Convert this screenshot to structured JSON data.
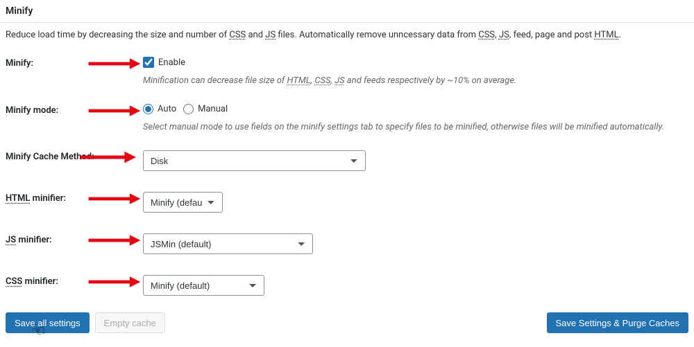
{
  "section": {
    "title": "Minify",
    "description_pre": "Reduce load time by decreasing the size and number of ",
    "description_css": "CSS",
    "description_mid1": " and ",
    "description_js": "JS",
    "description_mid2": " files. Automatically remove unncessary data from ",
    "description_css2": "CSS",
    "description_sep": ", ",
    "description_js2": "JS",
    "description_mid3": ", feed, page and post ",
    "description_html": "HTML",
    "description_end": "."
  },
  "rows": {
    "enable": {
      "label": "Minify:",
      "checkbox_label": "Enable",
      "help_pre": "Minification can decrease file size of ",
      "help_html": "HTML",
      "help_sep": ", ",
      "help_css": "CSS",
      "help_sep2": ", ",
      "help_js": "JS",
      "help_end": " and feeds respectively by ~10% on average."
    },
    "mode": {
      "label": "Minify mode:",
      "option_auto": "Auto",
      "option_manual": "Manual",
      "help": "Select manual mode to use fields on the minify settings tab to specify files to be minified, otherwise files will be minified automatically."
    },
    "cache": {
      "label": "Minify Cache Method:",
      "value": "Disk"
    },
    "html": {
      "label_abbr": "HTML",
      "label_suffix": " minifier:",
      "value": "Minify (default)"
    },
    "js": {
      "label_abbr": "JS",
      "label_suffix": " minifier:",
      "value": "JSMin (default)"
    },
    "css": {
      "label_abbr": "CSS",
      "label_suffix": " minifier:",
      "value": "Minify (default)"
    }
  },
  "footer": {
    "save": "Save all settings",
    "empty": "Empty cache",
    "purge": "Save Settings & Purge Caches"
  }
}
